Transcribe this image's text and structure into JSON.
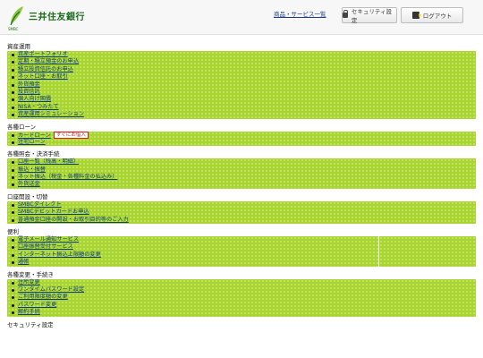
{
  "header": {
    "logo_text": "三井住友銀行",
    "logo_sub": "SMBC",
    "services_link": "商品・サービス一覧",
    "security_button": "セキュリティ設定",
    "logout_button": "ログアウト"
  },
  "sections": [
    {
      "title": "資産運用",
      "items": [
        {
          "label": "資産ポートフォリオ"
        },
        {
          "label": "定期・積立預金のお申込"
        },
        {
          "label": "積立投資信託のお申込"
        },
        {
          "label": "ネット口座・お取引"
        },
        {
          "label": "外貨預金"
        },
        {
          "label": "投資信託"
        },
        {
          "label": "個人向け国債"
        },
        {
          "label": "NISA・つみたて"
        },
        {
          "label": "資産運用シミュレーション"
        }
      ]
    },
    {
      "title": "各種ローン",
      "items": [
        {
          "label": "カードローン",
          "badge": "すぐにお借入"
        },
        {
          "label": "住宅ローン"
        }
      ]
    },
    {
      "title": "各種照会・決済手続",
      "items": [
        {
          "label": "口座一覧（残高・明細）"
        },
        {
          "label": "振込・振替"
        },
        {
          "label": "ネット振込（税金・各種料金の払込み）"
        },
        {
          "label": "外貨送金"
        }
      ]
    },
    {
      "title": "口座開設・切替",
      "items": [
        {
          "label": "SMBCダイレクト"
        },
        {
          "label": "SMBCデビットカードお申込"
        },
        {
          "label": "普通預金口座の開設・お取引目的等のご入力"
        }
      ]
    },
    {
      "title": "便利",
      "items": [
        {
          "label": "電子メール通知サービス"
        },
        {
          "label": "口座振替受付サービス"
        },
        {
          "label": "インターネット振込上限額の変更"
        },
        {
          "label": "通帳"
        }
      ]
    },
    {
      "title": "各種変更・手続き",
      "items": [
        {
          "label": "住所変更"
        },
        {
          "label": "ワンタイムパスワード設定"
        },
        {
          "label": "ご利用限度額の変更"
        },
        {
          "label": "パスワード変更"
        },
        {
          "label": "解約手続"
        }
      ]
    },
    {
      "title": "セキュリティ設定",
      "items": []
    }
  ]
}
